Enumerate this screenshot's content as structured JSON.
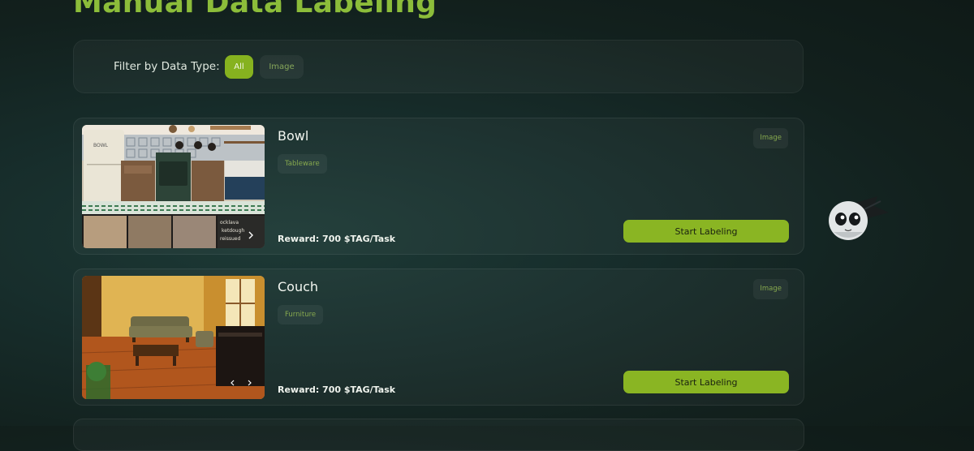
{
  "page": {
    "title": "Manual Data Labeling"
  },
  "filter": {
    "label": "Filter by Data Type:",
    "options": [
      "All",
      "Image"
    ],
    "selected": "All"
  },
  "tasks": [
    {
      "title": "Bowl",
      "tag": "Tableware",
      "type": "Image",
      "reward": "Reward: 700 $TAG/Task",
      "button_label": "Start Labeling",
      "thumbnail_text": "BOWL",
      "strip_text": [
        "ocklava",
        "ketdough",
        "reissued"
      ]
    },
    {
      "title": "Couch",
      "tag": "Furniture",
      "type": "Image",
      "reward": "Reward: 700 $TAG/Task",
      "button_label": "Start Labeling"
    }
  ],
  "colors": {
    "accent": "#86b21f",
    "title": "#8cbd3a",
    "background": "#172d2b",
    "chip_text": "#86a84e"
  },
  "icons": [
    "mascot-icon",
    "chevron-left-icon",
    "chevron-right-icon"
  ]
}
